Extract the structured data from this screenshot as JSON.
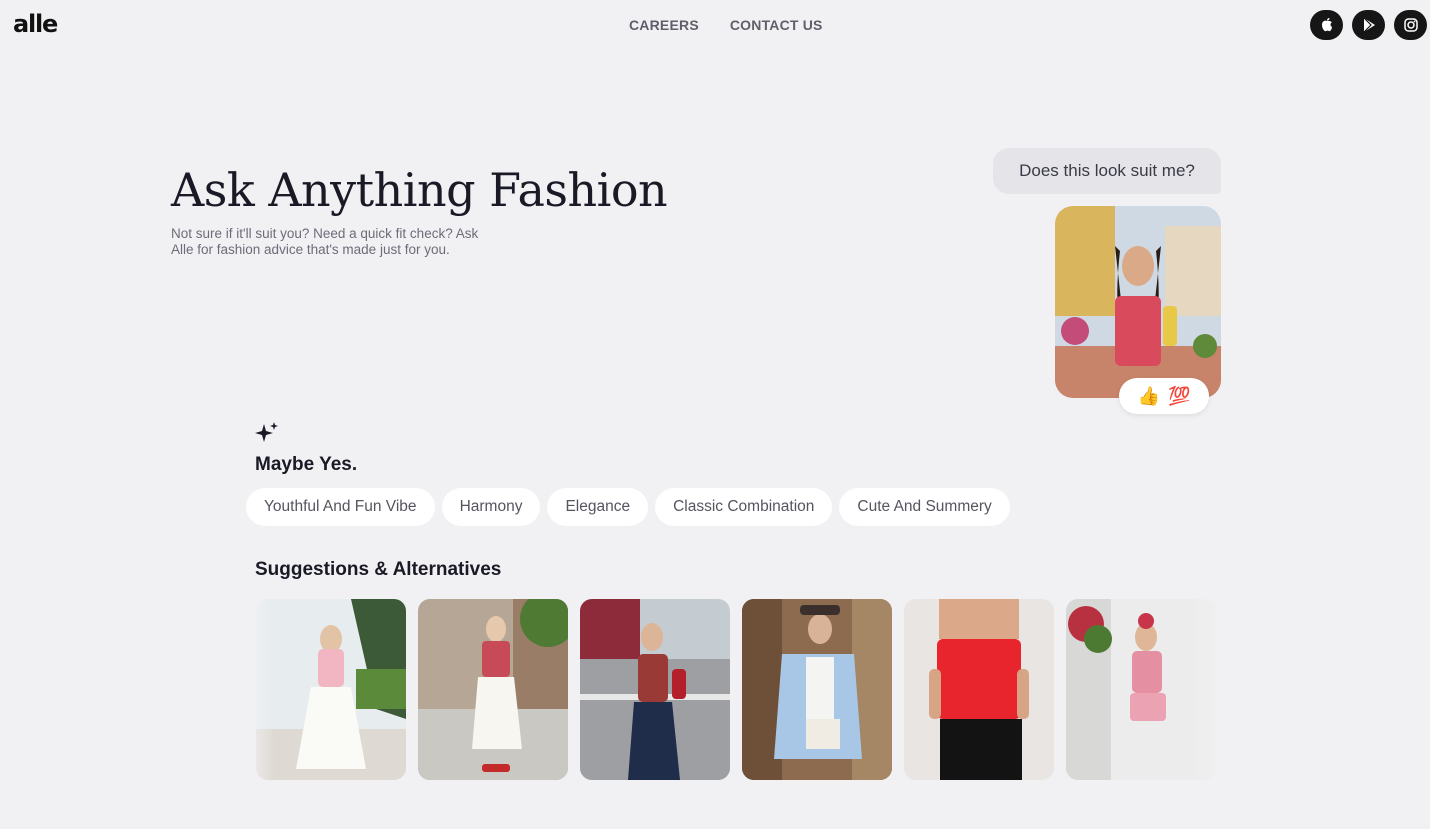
{
  "brand": {
    "logo": "alle"
  },
  "nav": {
    "careers": "CAREERS",
    "contact": "CONTACT US"
  },
  "social": [
    "apple-icon",
    "play-store-icon",
    "instagram-icon"
  ],
  "hero": {
    "title": "Ask Anything Fashion",
    "subtitle": "Not sure if it'll suit you? Need a quick fit check? Ask Alle for fashion advice that's made just for you."
  },
  "chat": {
    "question": "Does this look suit me?",
    "reactions": [
      "👍",
      "💯"
    ]
  },
  "verdict": {
    "title": "Maybe Yes.",
    "tags": [
      "Youthful And Fun Vibe",
      "Harmony",
      "Elegance",
      "Classic Combination",
      "Cute And Summery"
    ]
  },
  "suggestions": {
    "title": "Suggestions & Alternatives",
    "count": 6
  },
  "colors": {
    "background": "#f1f1f4",
    "chip_bg": "#ffffff",
    "accent_dark": "#161616"
  }
}
